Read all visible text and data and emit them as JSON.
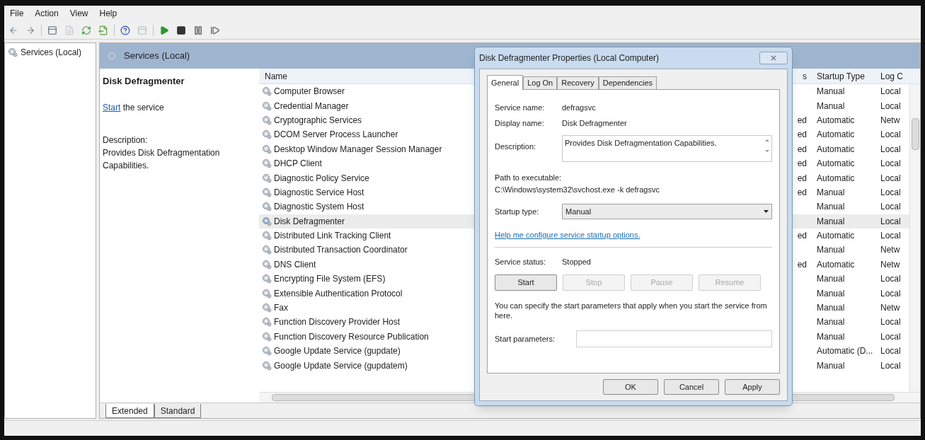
{
  "menu": [
    "File",
    "Action",
    "View",
    "Help"
  ],
  "toolbar": [
    {
      "kind": "back",
      "disabled": false
    },
    {
      "kind": "forward",
      "disabled": false
    },
    {
      "kind": "console",
      "disabled": false
    },
    {
      "kind": "properties",
      "disabled": true
    },
    {
      "kind": "refresh",
      "disabled": false
    },
    {
      "kind": "export",
      "disabled": false
    },
    {
      "kind": "help",
      "disabled": false
    },
    {
      "kind": "console",
      "disabled": true
    },
    {
      "kind": "play",
      "disabled": false
    },
    {
      "kind": "stop",
      "disabled": false
    },
    {
      "kind": "pause",
      "disabled": false
    },
    {
      "kind": "resume",
      "disabled": false
    }
  ],
  "tree": {
    "label": "Services (Local)"
  },
  "pane_header": "Services (Local)",
  "details": {
    "title": "Disk Defragmenter",
    "action_link": "Start",
    "action_rest": " the service",
    "description_label": "Description:",
    "description": "Provides Disk Defragmentation Capabilities."
  },
  "table": {
    "columns": [
      "Name",
      "s",
      "Startup Type",
      "Log C"
    ],
    "rows": [
      {
        "name": "Computer Browser",
        "status": "",
        "startup": "Manual",
        "logon": "Local",
        "selected": false
      },
      {
        "name": "Credential Manager",
        "status": "",
        "startup": "Manual",
        "logon": "Local",
        "selected": false
      },
      {
        "name": "Cryptographic Services",
        "status": "ed",
        "startup": "Automatic",
        "logon": "Netw",
        "selected": false
      },
      {
        "name": "DCOM Server Process Launcher",
        "status": "ed",
        "startup": "Automatic",
        "logon": "Local",
        "selected": false
      },
      {
        "name": "Desktop Window Manager Session Manager",
        "status": "ed",
        "startup": "Automatic",
        "logon": "Local",
        "selected": false
      },
      {
        "name": "DHCP Client",
        "status": "ed",
        "startup": "Automatic",
        "logon": "Local",
        "selected": false
      },
      {
        "name": "Diagnostic Policy Service",
        "status": "ed",
        "startup": "Automatic",
        "logon": "Local",
        "selected": false
      },
      {
        "name": "Diagnostic Service Host",
        "status": "ed",
        "startup": "Manual",
        "logon": "Local",
        "selected": false
      },
      {
        "name": "Diagnostic System Host",
        "status": "",
        "startup": "Manual",
        "logon": "Local",
        "selected": false
      },
      {
        "name": "Disk Defragmenter",
        "status": "",
        "startup": "Manual",
        "logon": "Local",
        "selected": true
      },
      {
        "name": "Distributed Link Tracking Client",
        "status": "ed",
        "startup": "Automatic",
        "logon": "Local",
        "selected": false
      },
      {
        "name": "Distributed Transaction Coordinator",
        "status": "",
        "startup": "Manual",
        "logon": "Netw",
        "selected": false
      },
      {
        "name": "DNS Client",
        "status": "ed",
        "startup": "Automatic",
        "logon": "Netw",
        "selected": false
      },
      {
        "name": "Encrypting File System (EFS)",
        "status": "",
        "startup": "Manual",
        "logon": "Local",
        "selected": false
      },
      {
        "name": "Extensible Authentication Protocol",
        "status": "",
        "startup": "Manual",
        "logon": "Local",
        "selected": false
      },
      {
        "name": "Fax",
        "status": "",
        "startup": "Manual",
        "logon": "Netw",
        "selected": false
      },
      {
        "name": "Function Discovery Provider Host",
        "status": "",
        "startup": "Manual",
        "logon": "Local",
        "selected": false
      },
      {
        "name": "Function Discovery Resource Publication",
        "status": "",
        "startup": "Manual",
        "logon": "Local",
        "selected": false
      },
      {
        "name": "Google Update Service (gupdate)",
        "status": "",
        "startup": "Automatic (D...",
        "logon": "Local",
        "selected": false
      },
      {
        "name": "Google Update Service (gupdatem)",
        "status": "",
        "startup": "Manual",
        "logon": "Local",
        "selected": false
      }
    ]
  },
  "view_tabs": [
    {
      "label": "Extended",
      "selected": true
    },
    {
      "label": "Standard",
      "selected": false
    }
  ],
  "dialog": {
    "title": "Disk Defragmenter Properties (Local Computer)",
    "tabs": [
      {
        "label": "General",
        "selected": true
      },
      {
        "label": "Log On",
        "selected": false
      },
      {
        "label": "Recovery",
        "selected": false
      },
      {
        "label": "Dependencies",
        "selected": false
      }
    ],
    "service_name_label": "Service name:",
    "service_name": "defragsvc",
    "display_name_label": "Display name:",
    "display_name": "Disk Defragmenter",
    "description_label": "Description:",
    "description": "Provides Disk Defragmentation Capabilities.",
    "path_label": "Path to executable:",
    "path": "C:\\Windows\\system32\\svchost.exe -k defragsvc",
    "startup_label": "Startup type:",
    "startup_value": "Manual",
    "help_link": "Help me configure service startup options.",
    "status_label": "Service status:",
    "status": "Stopped",
    "control_buttons": [
      {
        "label": "Start",
        "disabled": false
      },
      {
        "label": "Stop",
        "disabled": true
      },
      {
        "label": "Pause",
        "disabled": true
      },
      {
        "label": "Resume",
        "disabled": true
      }
    ],
    "hint": "You can specify the start parameters that apply when you start the service from here.",
    "params_label": "Start parameters:",
    "buttons": [
      "OK",
      "Cancel",
      "Apply"
    ]
  }
}
